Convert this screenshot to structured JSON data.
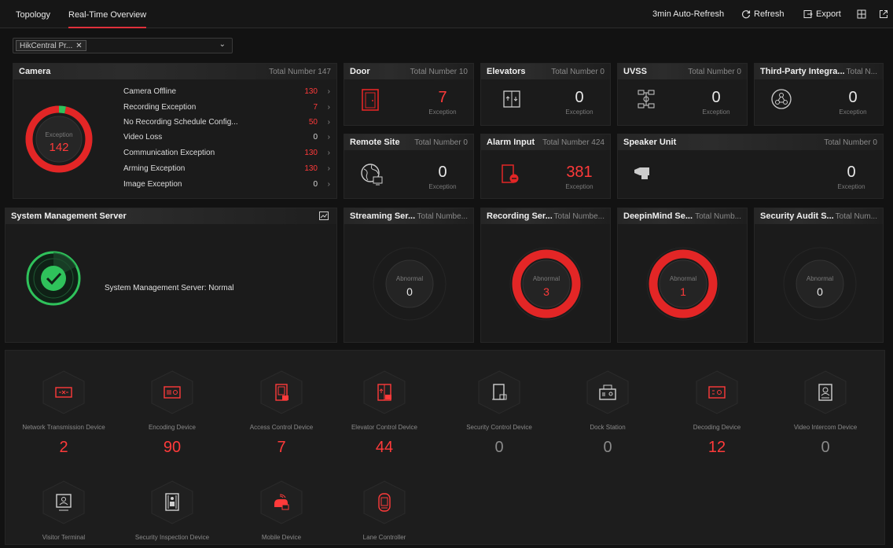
{
  "tabs": [
    {
      "label": "Topology",
      "active": false
    },
    {
      "label": "Real-Time Overview",
      "active": true
    }
  ],
  "toolbar": {
    "auto_refresh": "3min Auto-Refresh",
    "refresh": "Refresh",
    "export": "Export"
  },
  "filter": {
    "chip": "HikCentral Pr..."
  },
  "camera": {
    "title": "Camera",
    "total": "Total Number 147",
    "ring_label": "Exception",
    "ring_value": "142",
    "ring_fraction": 0.966,
    "rows": [
      {
        "label": "Camera Offline",
        "value": "130"
      },
      {
        "label": "Recording Exception",
        "value": "7"
      },
      {
        "label": "No Recording Schedule Config...",
        "value": "50"
      },
      {
        "label": "Video Loss",
        "value": "0"
      },
      {
        "label": "Communication Exception",
        "value": "130"
      },
      {
        "label": "Arming Exception",
        "value": "130"
      },
      {
        "label": "Image Exception",
        "value": "0"
      }
    ]
  },
  "cards": {
    "door": {
      "title": "Door",
      "total": "Total Number 10",
      "value": "7",
      "label": "Exception"
    },
    "elevators": {
      "title": "Elevators",
      "total": "Total Number 0",
      "value": "0",
      "label": "Exception"
    },
    "uvss": {
      "title": "UVSS",
      "total": "Total Number 0",
      "value": "0",
      "label": "Exception"
    },
    "third_party": {
      "title": "Third-Party Integra...",
      "total": "Total N...",
      "value": "0",
      "label": "Exception"
    },
    "remote_site": {
      "title": "Remote Site",
      "total": "Total Number 0",
      "value": "0",
      "label": "Exception"
    },
    "alarm_input": {
      "title": "Alarm Input",
      "total": "Total Number 424",
      "value": "381",
      "label": "Exception"
    },
    "speaker_unit": {
      "title": "Speaker Unit",
      "total": "Total Number 0",
      "value": "0",
      "label": "Exception"
    }
  },
  "sms": {
    "title": "System Management Server",
    "status": "System Management Server: Normal"
  },
  "servers": [
    {
      "title": "Streaming Ser...",
      "total": "Total Numbe...",
      "label": "Abnormal",
      "value": "0",
      "fraction": 0
    },
    {
      "title": "Recording Ser...",
      "total": "Total Numbe...",
      "label": "Abnormal",
      "value": "3",
      "fraction": 1
    },
    {
      "title": "DeepinMind Se...",
      "total": "Total Numb...",
      "label": "Abnormal",
      "value": "1",
      "fraction": 1
    },
    {
      "title": "Security Audit S...",
      "total": "Total Num...",
      "label": "Abnormal",
      "value": "0",
      "fraction": 0
    }
  ],
  "devices": [
    {
      "label": "Network Transmission Device",
      "value": "2",
      "icon": "network-transmission-icon",
      "status": "red"
    },
    {
      "label": "Encoding Device",
      "value": "90",
      "icon": "encoding-device-icon",
      "status": "red"
    },
    {
      "label": "Access Control Device",
      "value": "7",
      "icon": "access-control-icon",
      "status": "red"
    },
    {
      "label": "Elevator Control Device",
      "value": "44",
      "icon": "elevator-control-icon",
      "status": "red"
    },
    {
      "label": "Security Control Device",
      "value": "0",
      "icon": "security-control-icon",
      "status": "grey"
    },
    {
      "label": "Dock Station",
      "value": "0",
      "icon": "dock-station-icon",
      "status": "grey"
    },
    {
      "label": "Decoding Device",
      "value": "12",
      "icon": "decoding-device-icon",
      "status": "red"
    },
    {
      "label": "Video Intercom Device",
      "value": "0",
      "icon": "video-intercom-icon",
      "status": "grey"
    },
    {
      "label": "Visitor Terminal",
      "value": "",
      "icon": "visitor-terminal-icon",
      "status": "grey"
    },
    {
      "label": "Security Inspection Device",
      "value": "",
      "icon": "security-inspection-icon",
      "status": "grey"
    },
    {
      "label": "Mobile Device",
      "value": "",
      "icon": "mobile-device-icon",
      "status": "red"
    },
    {
      "label": "Lane Controller",
      "value": "",
      "icon": "lane-controller-icon",
      "status": "red"
    }
  ],
  "colors": {
    "accent": "#e0303b",
    "alert": "#ff3a3a",
    "ok": "#2fc25b",
    "panel": "#1b1b1b"
  }
}
